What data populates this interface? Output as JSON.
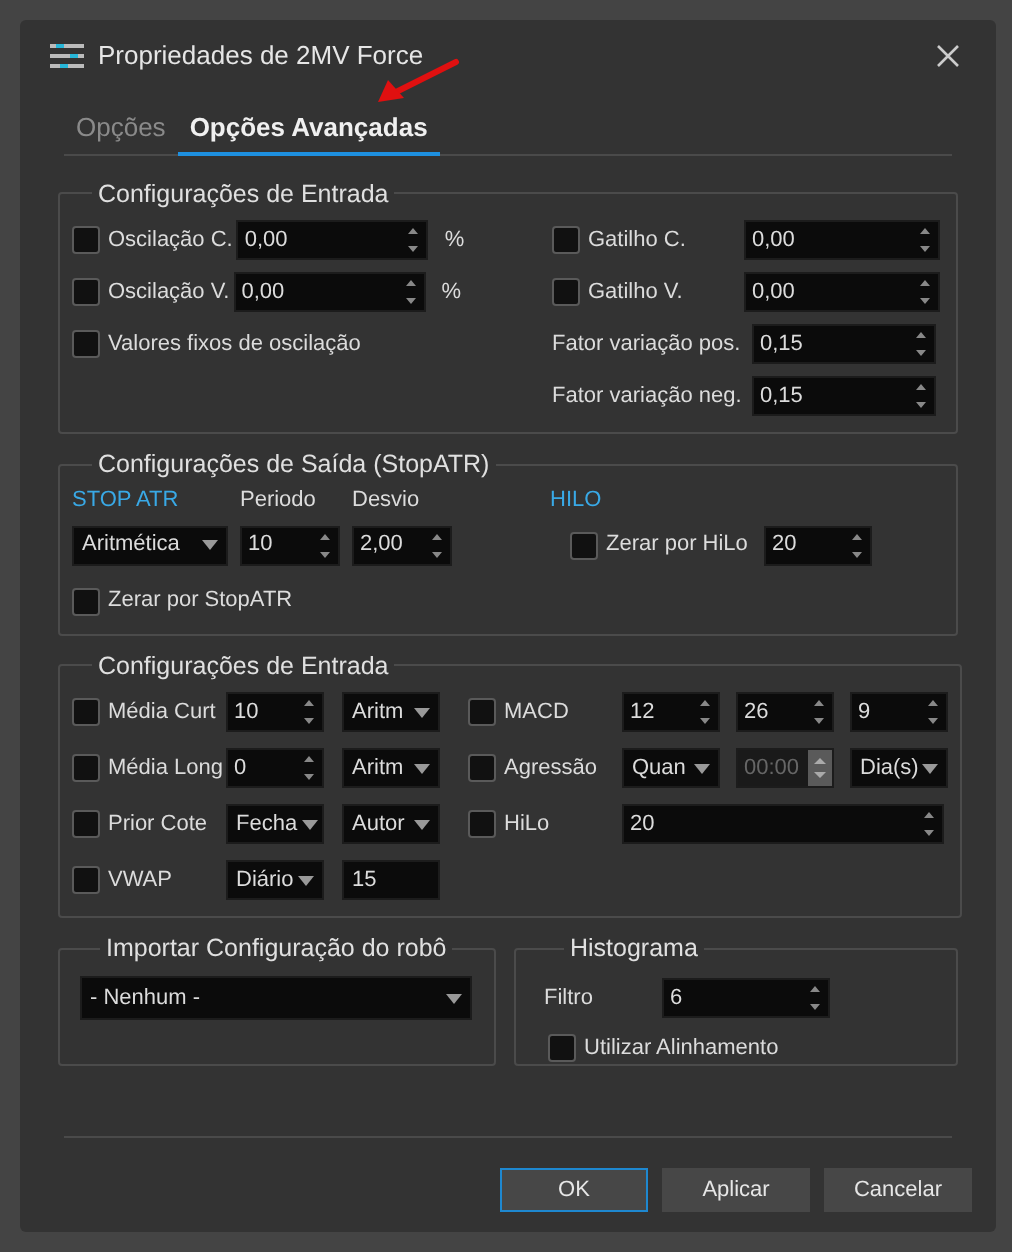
{
  "window": {
    "title": "Propriedades de 2MV Force"
  },
  "tabs": [
    {
      "label": "Opções",
      "selected": false
    },
    {
      "label": "Opções Avançadas",
      "selected": true
    }
  ],
  "entry_settings": {
    "title": "Configurações de Entrada",
    "oscillation": [
      {
        "label": "Oscilação C.",
        "checked": false,
        "value": "0,00",
        "unit": "%"
      },
      {
        "label": "Oscilação V.",
        "checked": false,
        "value": "0,00",
        "unit": "%"
      }
    ],
    "fixed_values": {
      "label": "Valores fixos de oscilação",
      "checked": false
    },
    "triggers": [
      {
        "label": "Gatilho C.",
        "checked": false,
        "value": "0,00"
      },
      {
        "label": "Gatilho  V.",
        "checked": false,
        "value": "0,00"
      }
    ],
    "factors": [
      {
        "label": "Fator variação pos.",
        "value": "0,15"
      },
      {
        "label": "Fator variação neg.",
        "value": "0,15"
      }
    ]
  },
  "exit_settings": {
    "title": "Configurações de Saída (StopATR)",
    "stop_atr": {
      "heading": "STOP ATR",
      "type": "Aritmética"
    },
    "period": {
      "label": "Periodo",
      "value": "10"
    },
    "deviation": {
      "label": "Desvio",
      "value": "2,00"
    },
    "zero_stop_atr": {
      "label": "Zerar por StopATR",
      "checked": false
    },
    "hilo": {
      "heading": "HILO",
      "label": "Zerar por HiLo",
      "checked": false,
      "value": "20"
    }
  },
  "entry_settings_2": {
    "title": "Configurações de Entrada",
    "rows": [
      {
        "left": {
          "label": "Média Curt",
          "checked": false
        },
        "left_controls": [
          {
            "kind": "spin",
            "value": "10",
            "disabled": false
          },
          {
            "kind": "combo",
            "value": "Aritm",
            "disabled": false
          }
        ],
        "right": {
          "label": "MACD",
          "checked": false
        },
        "right_controls": [
          {
            "kind": "spin",
            "value": "12",
            "disabled": false
          },
          {
            "kind": "spin",
            "value": "26",
            "disabled": false
          },
          {
            "kind": "spin",
            "value": "9",
            "disabled": false
          }
        ]
      },
      {
        "left": {
          "label": "Média Long",
          "checked": false
        },
        "left_controls": [
          {
            "kind": "spin",
            "value": "0",
            "disabled": false
          },
          {
            "kind": "combo",
            "value": "Aritm",
            "disabled": false
          }
        ],
        "right": {
          "label": "Agressão",
          "checked": false
        },
        "right_controls": [
          {
            "kind": "combo",
            "value": "Quan",
            "disabled": false
          },
          {
            "kind": "spin",
            "value": "00:00",
            "disabled": true
          },
          {
            "kind": "combo",
            "value": "Dia(s)",
            "disabled": false
          }
        ]
      },
      {
        "left": {
          "label": "Prior Cote",
          "checked": false
        },
        "left_controls": [
          {
            "kind": "combo",
            "value": "Fecha",
            "disabled": false
          },
          {
            "kind": "combo",
            "value": "Autor",
            "disabled": false
          }
        ],
        "right": {
          "label": "HiLo",
          "checked": false
        },
        "right_controls": [
          {
            "kind": "spin",
            "value": "20",
            "disabled": false
          }
        ]
      },
      {
        "left": {
          "label": "VWAP",
          "checked": false
        },
        "left_controls": [
          {
            "kind": "combo",
            "value": "Diário",
            "disabled": false
          },
          {
            "kind": "text",
            "value": "15",
            "disabled": false
          }
        ]
      }
    ]
  },
  "import": {
    "title": "Importar Configuração do robô",
    "value": "- Nenhum -"
  },
  "histogram": {
    "title": "Histograma",
    "filter_label": "Filtro",
    "filter_value": "6",
    "alignment": {
      "label": "Utilizar Alinhamento",
      "checked": false
    }
  },
  "buttons": [
    {
      "label": "OK",
      "default": true
    },
    {
      "label": "Aplicar",
      "default": false
    },
    {
      "label": "Cancelar",
      "default": false
    }
  ]
}
